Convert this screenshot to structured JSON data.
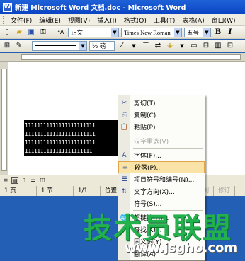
{
  "window": {
    "title": "新建 Microsoft Word 文档.doc - Microsoft Word",
    "icon": "word-icon"
  },
  "menubar": {
    "items": [
      "文件(F)",
      "编辑(E)",
      "视图(V)",
      "插入(I)",
      "格式(O)",
      "工具(T)",
      "表格(A)",
      "窗口(W)"
    ]
  },
  "toolbar": {
    "style_value": "正文",
    "font_value": "Times New Roman",
    "size_value": "五号",
    "bold": "B",
    "italic": "I",
    "line_weight_label": "½ 磅"
  },
  "document": {
    "selected_lines": [
      "11111111111111111111111",
      "11111111111111111111111",
      "11111111111111111111111",
      "1111111111111111111111"
    ]
  },
  "statusbar": {
    "page": "1 页",
    "section": "1 节",
    "pages": "1/1",
    "position": "位置",
    "rec": "录制",
    "trk": "修订"
  },
  "context_menu": {
    "items": [
      {
        "label": "剪切(T)",
        "icon": "scissors-icon",
        "glyph": "✂",
        "disabled": false
      },
      {
        "label": "复制(C)",
        "icon": "copy-icon",
        "glyph": "⎘",
        "disabled": false
      },
      {
        "label": "粘贴(P)",
        "icon": "paste-icon",
        "glyph": "📋",
        "disabled": false
      },
      {
        "label": "汉字重选(V)",
        "icon": "",
        "glyph": "",
        "disabled": true
      },
      {
        "label": "字体(F)...",
        "icon": "font-icon",
        "glyph": "A",
        "disabled": false
      },
      {
        "label": "段落(P)...",
        "icon": "paragraph-icon",
        "glyph": "≡",
        "disabled": false
      },
      {
        "label": "项目符号和编号(N)...",
        "icon": "bullets-icon",
        "glyph": "☰",
        "disabled": false
      },
      {
        "label": "文字方向(X)...",
        "icon": "text-direction-icon",
        "glyph": "⇅",
        "disabled": false
      },
      {
        "label": "符号(S)...",
        "icon": "",
        "glyph": "",
        "disabled": false
      },
      {
        "label": "超链接(H)...",
        "icon": "hyperlink-icon",
        "glyph": "🌐",
        "disabled": false
      },
      {
        "label": "查找(K)...",
        "icon": "lookup-icon",
        "glyph": "",
        "disabled": false
      },
      {
        "label": "同义词(Y)",
        "icon": "",
        "glyph": "",
        "disabled": false
      },
      {
        "label": "翻译(A)",
        "icon": "translate-icon",
        "glyph": "",
        "disabled": false
      }
    ],
    "hover_index": 5
  },
  "watermark": {
    "main": "技术员联盟",
    "url": "www.jsgho.com"
  }
}
